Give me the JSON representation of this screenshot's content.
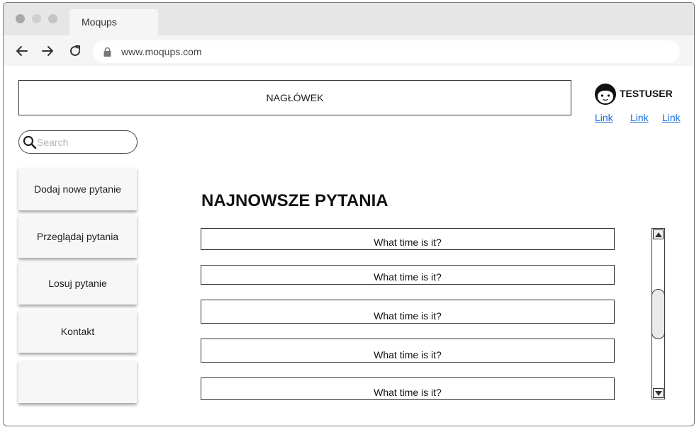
{
  "browser": {
    "tab_title": "Moqups",
    "url": "www.moqups.com",
    "traffic_lights": [
      "#b0b0b0",
      "#cccccc",
      "#c7c7c7"
    ]
  },
  "header": {
    "label": "NAGŁÓWEK"
  },
  "user": {
    "name": "TESTUSER",
    "links": [
      "Link",
      "Link",
      "Link"
    ]
  },
  "search": {
    "placeholder": "Search",
    "value": ""
  },
  "sidebar": {
    "items": [
      {
        "label": "Dodaj nowe pytanie"
      },
      {
        "label": "Przeglądaj pytania"
      },
      {
        "label": "Losuj pytanie"
      },
      {
        "label": "Kontakt"
      },
      {
        "label": ""
      }
    ]
  },
  "main": {
    "title": "NAJNOWSZE PYTANIA",
    "questions": [
      "What time is it?",
      "What time is it?",
      "What time is it?",
      "What time is it?",
      "What time is it?"
    ]
  },
  "colors": {
    "link": "#1a6fd6",
    "titlebar": "#e6e6e6",
    "toolbar": "#f5f5f5"
  }
}
